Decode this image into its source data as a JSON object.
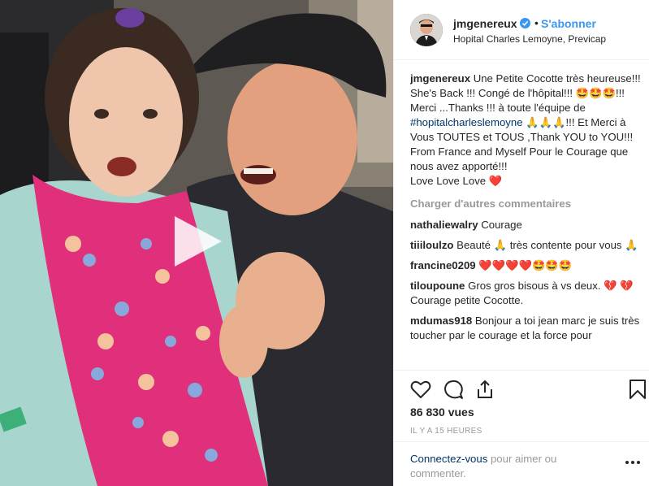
{
  "header": {
    "username": "jmgenereux",
    "follow_label": "S'abonner",
    "separator": "•",
    "location": "Hopital Charles Lemoyne, Previcap"
  },
  "caption": {
    "username": "jmgenereux",
    "text_1": "Une Petite Cocotte très heureuse!!! She's Back !!! Congé de l'hôpital!!! 🤩🤩🤩!!! Merci ...Thanks !!! à toute l'équipe de ",
    "hashtag": "#hopitalcharleslemoyne",
    "text_2": " 🙏🙏🙏!!! Et Merci à Vous TOUTES et TOUS ,Thank YOU to YOU!!! From France and Myself Pour le Courage que nous avez apporté!!!",
    "text_3": "Love Love Love ❤️"
  },
  "load_more_label": "Charger d'autres commentaires",
  "comments": [
    {
      "user": "nathaliewalry",
      "text": "Courage"
    },
    {
      "user": "tiiiloulzo",
      "text": "Beauté 🙏 très contente pour vous 🙏"
    },
    {
      "user": "francine0209",
      "text": "❤️❤️❤️❤️🤩🤩🤩"
    },
    {
      "user": "tiloupoune",
      "text": "Gros gros bisous à vs deux. 💔 💔 Courage petite Cocotte."
    },
    {
      "user": "mdumas918",
      "text": "Bonjour a toi jean marc je suis très toucher par le courage et la force pour"
    }
  ],
  "icons": {
    "like": "heart-icon",
    "comment": "comment-icon",
    "share": "share-icon",
    "save": "bookmark-icon",
    "more": "more-icon",
    "play": "play-icon",
    "verified": "verified-badge-icon"
  },
  "views": "86 830 vues",
  "timestamp": "IL Y A 15 HEURES",
  "footer": {
    "login_link": "Connectez-vous",
    "login_text": " pour aimer ou commenter."
  },
  "colors": {
    "link_blue": "#3897f0",
    "hashtag_blue": "#003569",
    "muted": "#999999",
    "border": "#efefef"
  }
}
